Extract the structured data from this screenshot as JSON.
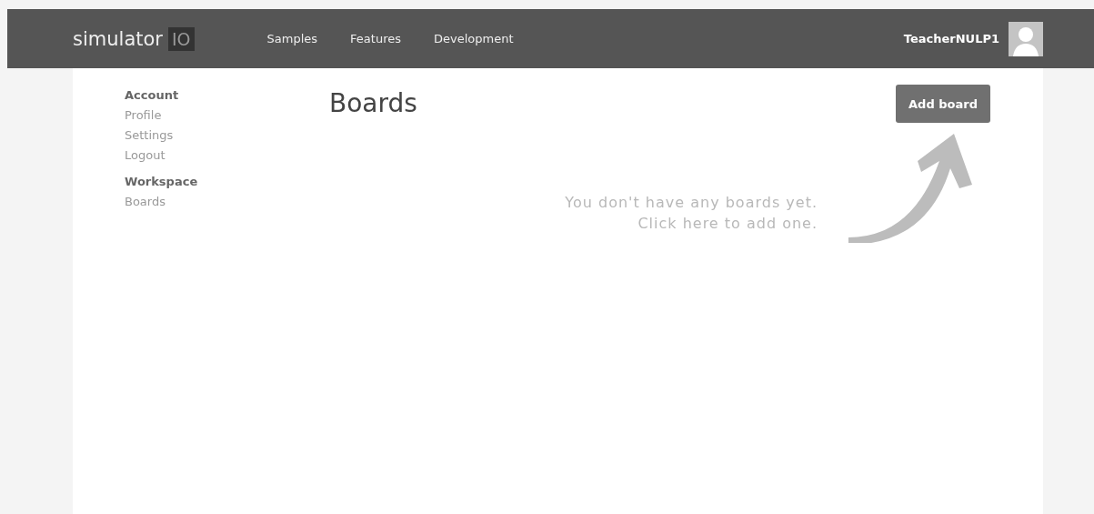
{
  "header": {
    "logo": {
      "text": "simulator",
      "badge": "IO"
    },
    "nav": [
      "Samples",
      "Features",
      "Development"
    ],
    "user": {
      "name": "TeacherNULP1"
    }
  },
  "sidebar": {
    "groups": [
      {
        "title": "Account",
        "items": [
          "Profile",
          "Settings",
          "Logout"
        ]
      },
      {
        "title": "Workspace",
        "items": [
          "Boards"
        ]
      }
    ]
  },
  "main": {
    "title": "Boards",
    "add_button": "Add board",
    "empty_message": [
      "You don't have any boards yet.",
      "Click here to add one."
    ]
  }
}
